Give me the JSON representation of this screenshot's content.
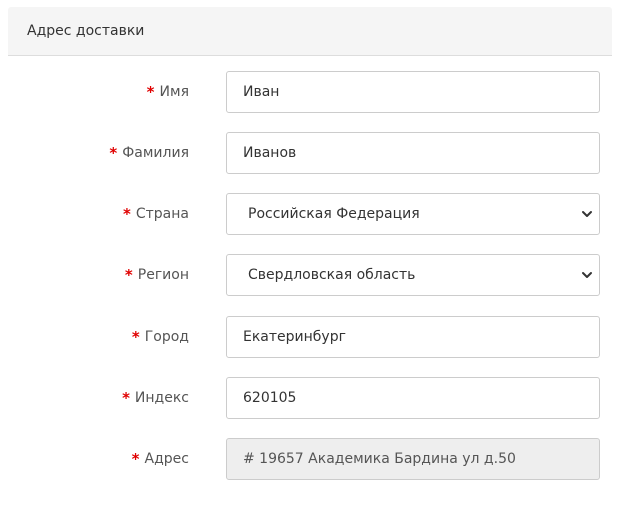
{
  "panel": {
    "title": "Адрес доставки"
  },
  "required_marker": "*",
  "fields": {
    "first_name": {
      "label": "Имя",
      "value": "Иван"
    },
    "last_name": {
      "label": "Фамилия",
      "value": "Иванов"
    },
    "country": {
      "label": "Страна",
      "value": "Российская Федерация"
    },
    "region": {
      "label": "Регион",
      "value": "Свердловская область"
    },
    "city": {
      "label": "Город",
      "value": "Екатеринбург"
    },
    "postcode": {
      "label": "Индекс",
      "value": "620105"
    },
    "address": {
      "label": "Адрес",
      "value": "# 19657 Академика Бардина ул д.50"
    }
  },
  "icons": {
    "select_arrow": "chevron-down-icon"
  },
  "colors": {
    "required": "#e00000",
    "border": "#cccccc",
    "header_bg": "#f5f5f5",
    "readonly_bg": "#eeeeee"
  }
}
